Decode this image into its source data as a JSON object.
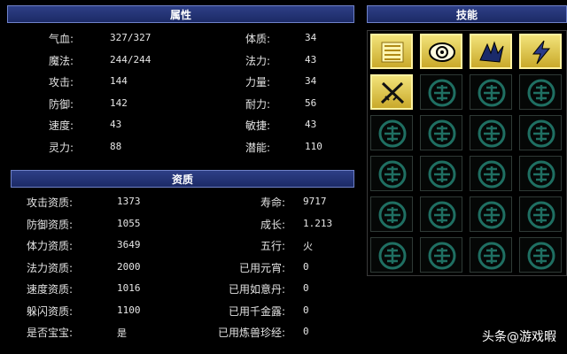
{
  "attributes": {
    "title": "属性",
    "left": [
      {
        "label": "气血:",
        "value": "327/327"
      },
      {
        "label": "魔法:",
        "value": "244/244"
      },
      {
        "label": "攻击:",
        "value": "144"
      },
      {
        "label": "防御:",
        "value": "142"
      },
      {
        "label": "速度:",
        "value": "43"
      },
      {
        "label": "灵力:",
        "value": "88"
      }
    ],
    "right": [
      {
        "label": "体质:",
        "value": "34"
      },
      {
        "label": "法力:",
        "value": "43"
      },
      {
        "label": "力量:",
        "value": "34"
      },
      {
        "label": "耐力:",
        "value": "56"
      },
      {
        "label": "敏捷:",
        "value": "43"
      },
      {
        "label": "潜能:",
        "value": "110"
      }
    ]
  },
  "aptitude": {
    "title": "资质",
    "left": [
      {
        "label": "攻击资质:",
        "value": "1373"
      },
      {
        "label": "防御资质:",
        "value": "1055"
      },
      {
        "label": "体力资质:",
        "value": "3649"
      },
      {
        "label": "法力资质:",
        "value": "2000"
      },
      {
        "label": "速度资质:",
        "value": "1016"
      },
      {
        "label": "躲闪资质:",
        "value": "1100"
      },
      {
        "label": "是否宝宝:",
        "value": "是"
      }
    ],
    "right": [
      {
        "label": "寿命:",
        "value": "9717"
      },
      {
        "label": "成长:",
        "value": "1.213"
      },
      {
        "label": "五行:",
        "value": "火"
      },
      {
        "label": "已用元宵:",
        "value": "0"
      },
      {
        "label": "已用如意丹:",
        "value": "0"
      },
      {
        "label": "已用千金露:",
        "value": "0"
      },
      {
        "label": "已用炼兽珍经:",
        "value": "0"
      }
    ]
  },
  "skills": {
    "title": "技能",
    "learned": [
      {
        "icon": "golden-scales-icon"
      },
      {
        "icon": "eye-swirl-icon"
      },
      {
        "icon": "winged-beast-icon"
      },
      {
        "icon": "lightning-bolt-icon"
      },
      {
        "icon": "crossed-swords-icon"
      }
    ],
    "empty_slot_icon": "teal-emblem-icon",
    "colors": {
      "skill_bg": "#e0c84a",
      "empty_emblem": "#1f6f62"
    }
  },
  "watermark": "头条@游戏暇"
}
